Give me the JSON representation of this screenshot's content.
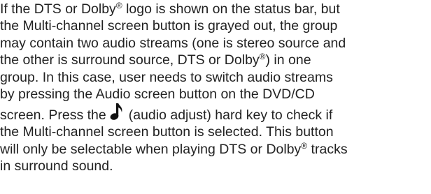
{
  "paragraph": {
    "l1a": "If the DTS or Dolby",
    "l1b": " logo is shown on the status bar, but",
    "l2": "the Multi-channel screen button is grayed out, the group",
    "l3": "may contain two audio streams (one is stereo source and",
    "l4a": "the other is surround source, DTS or Dolby",
    "l4b": ") in one",
    "l5": "group. In this case, user needs to switch audio streams",
    "l6": "by pressing the Audio screen button on the DVD/CD",
    "l7a": "screen. Press the",
    "l7b": "(audio adjust) hard key to check if",
    "l8": "the Multi-channel screen button is selected. This button",
    "l9a": "will only be selectable when playing DTS or Dolby",
    "l9b": " tracks",
    "l10": "in surround sound.",
    "registered_mark": "®",
    "icon": "music-note-icon"
  }
}
